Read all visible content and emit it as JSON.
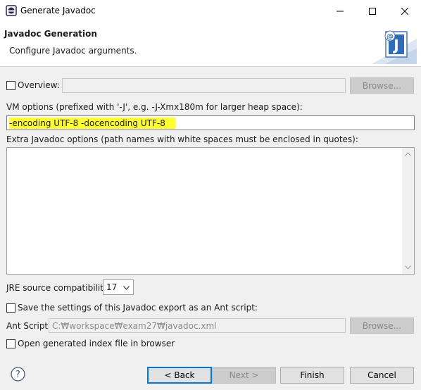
{
  "window": {
    "title": "Generate Javadoc"
  },
  "banner": {
    "title": "Javadoc Generation",
    "description": "Configure Javadoc arguments."
  },
  "overview": {
    "label": "Overview:",
    "checked": false,
    "value": "",
    "browse_label": "Browse..."
  },
  "vm_options": {
    "label": "VM options (prefixed with '-J', e.g. -J-Xmx180m for larger heap space):",
    "value": "-encoding UTF-8 -docencoding UTF-8"
  },
  "extra_options": {
    "label": "Extra Javadoc options (path names with white spaces must be enclosed in quotes):",
    "value": ""
  },
  "jre": {
    "label": "JRE source compatibility:",
    "selected": "17"
  },
  "save_ant": {
    "label": "Save the settings of this Javadoc export as an Ant script:",
    "checked": false
  },
  "ant_script": {
    "label": "Ant Script:",
    "value": "C:₩workspace₩exam27₩javadoc.xml",
    "browse_label": "Browse..."
  },
  "open_browser": {
    "label": "Open generated index file in browser",
    "checked": false
  },
  "footer": {
    "help_icon": "question-mark",
    "back_label": "< Back",
    "next_label": "Next >",
    "finish_label": "Finish",
    "cancel_label": "Cancel"
  },
  "colors": {
    "highlight": "#ffff33",
    "default_button_border": "#0078d7"
  }
}
